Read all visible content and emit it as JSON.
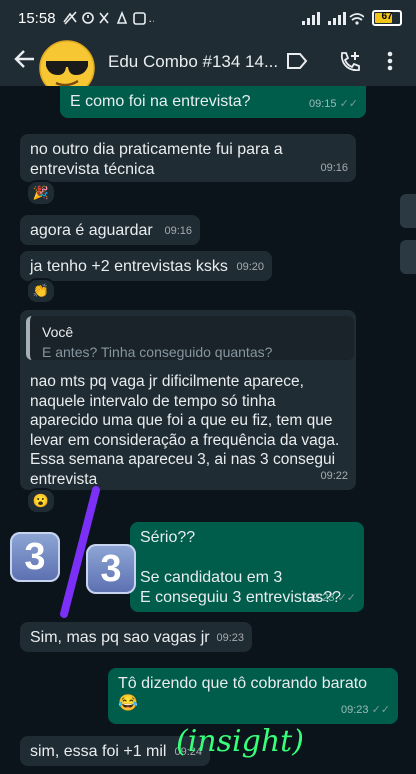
{
  "status": {
    "time": "15:58",
    "battery": "67",
    "left_icons": "notification icons"
  },
  "header": {
    "title": "Edu Combo #134 14...",
    "avatar_emoji": "😎"
  },
  "messages": [
    {
      "text": "E como foi na entrevista?",
      "time": "09:15"
    },
    {
      "text_line1": "no outro dia praticamente fui para a",
      "text_line2": "entrevista técnica",
      "time": "09:16",
      "reaction": "🎉"
    },
    {
      "text": "agora é aguardar",
      "time": "09:16"
    },
    {
      "text": "ja tenho +2 entrevistas ksks",
      "time": "09:20",
      "reaction": "👏"
    },
    {
      "quote_author": "Você",
      "quote_text": "E antes? Tinha conseguido quantas?",
      "lines": [
        "nao mts pq vaga jr dificilmente aparece,",
        "naquele intervalo de tempo só tinha",
        "aparecido uma que foi a que eu fiz, tem que",
        "levar em consideração a frequência da vaga.",
        "Essa semana apareceu 3, ai nas 3 consegui",
        "entrevista"
      ],
      "time": "09:22",
      "reaction": "😮"
    },
    {
      "line1": "Sério??",
      "line2": "Se candidatou em 3",
      "line3": "E conseguiu 3 entrevistas??",
      "time": "09:23"
    },
    {
      "text": "Sim, mas pq sao vagas jr",
      "time": "09:23"
    },
    {
      "text": "Tô dizendo que tô cobrando barato 😂",
      "time": "09:23"
    },
    {
      "text": "sim, essa foi +1 mil",
      "time": "09:24"
    }
  ],
  "overlay": {
    "emoji_digit": "3",
    "scribble": "(insight)"
  },
  "colors": {
    "incoming": "#202c33",
    "outgoing": "#005c4b",
    "background": "#0b141a",
    "header": "#1f2c34",
    "scribble": "#37ff7a",
    "stroke": "#7b2ff7"
  }
}
